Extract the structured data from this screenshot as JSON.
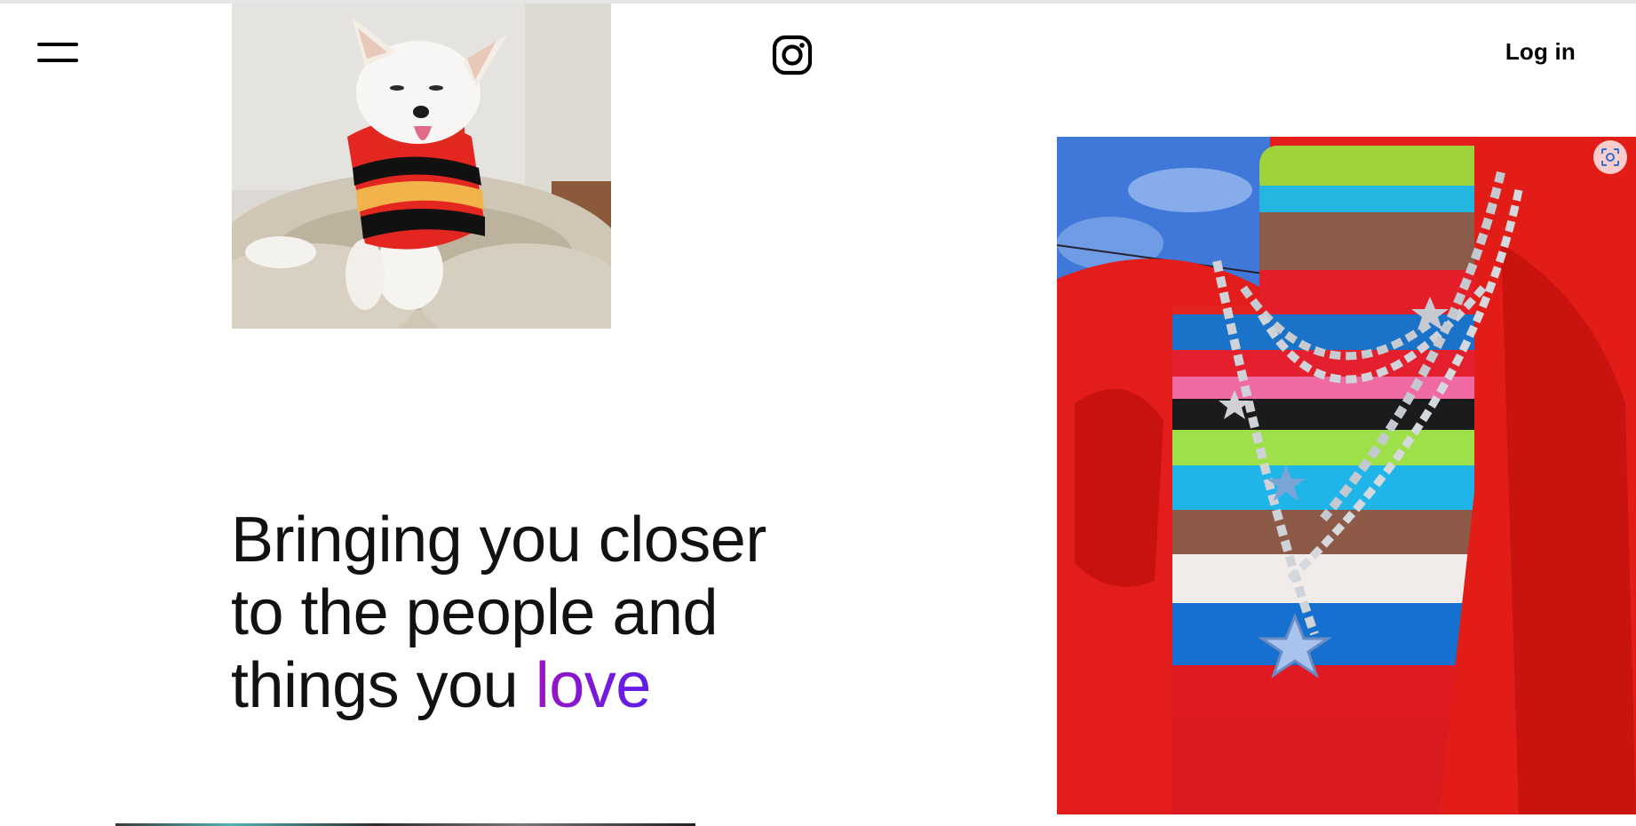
{
  "header": {
    "menu_icon": "hamburger-menu-icon",
    "logo_icon": "instagram-logo-icon",
    "login_label": "Log in"
  },
  "hero": {
    "line1": "Bringing you closer",
    "line2": "to the people and",
    "line3_prefix": "things you ",
    "accent_word": "love"
  },
  "images": {
    "dog_photo": "dog in striped sweater photo",
    "fashion_photo": "striped turtleneck with star chains photo",
    "scan_icon": "visual-search-icon"
  },
  "colors": {
    "accent_start": "#9b14c2",
    "accent_end": "#5d1ee8",
    "text": "#111111",
    "background": "#ffffff"
  }
}
